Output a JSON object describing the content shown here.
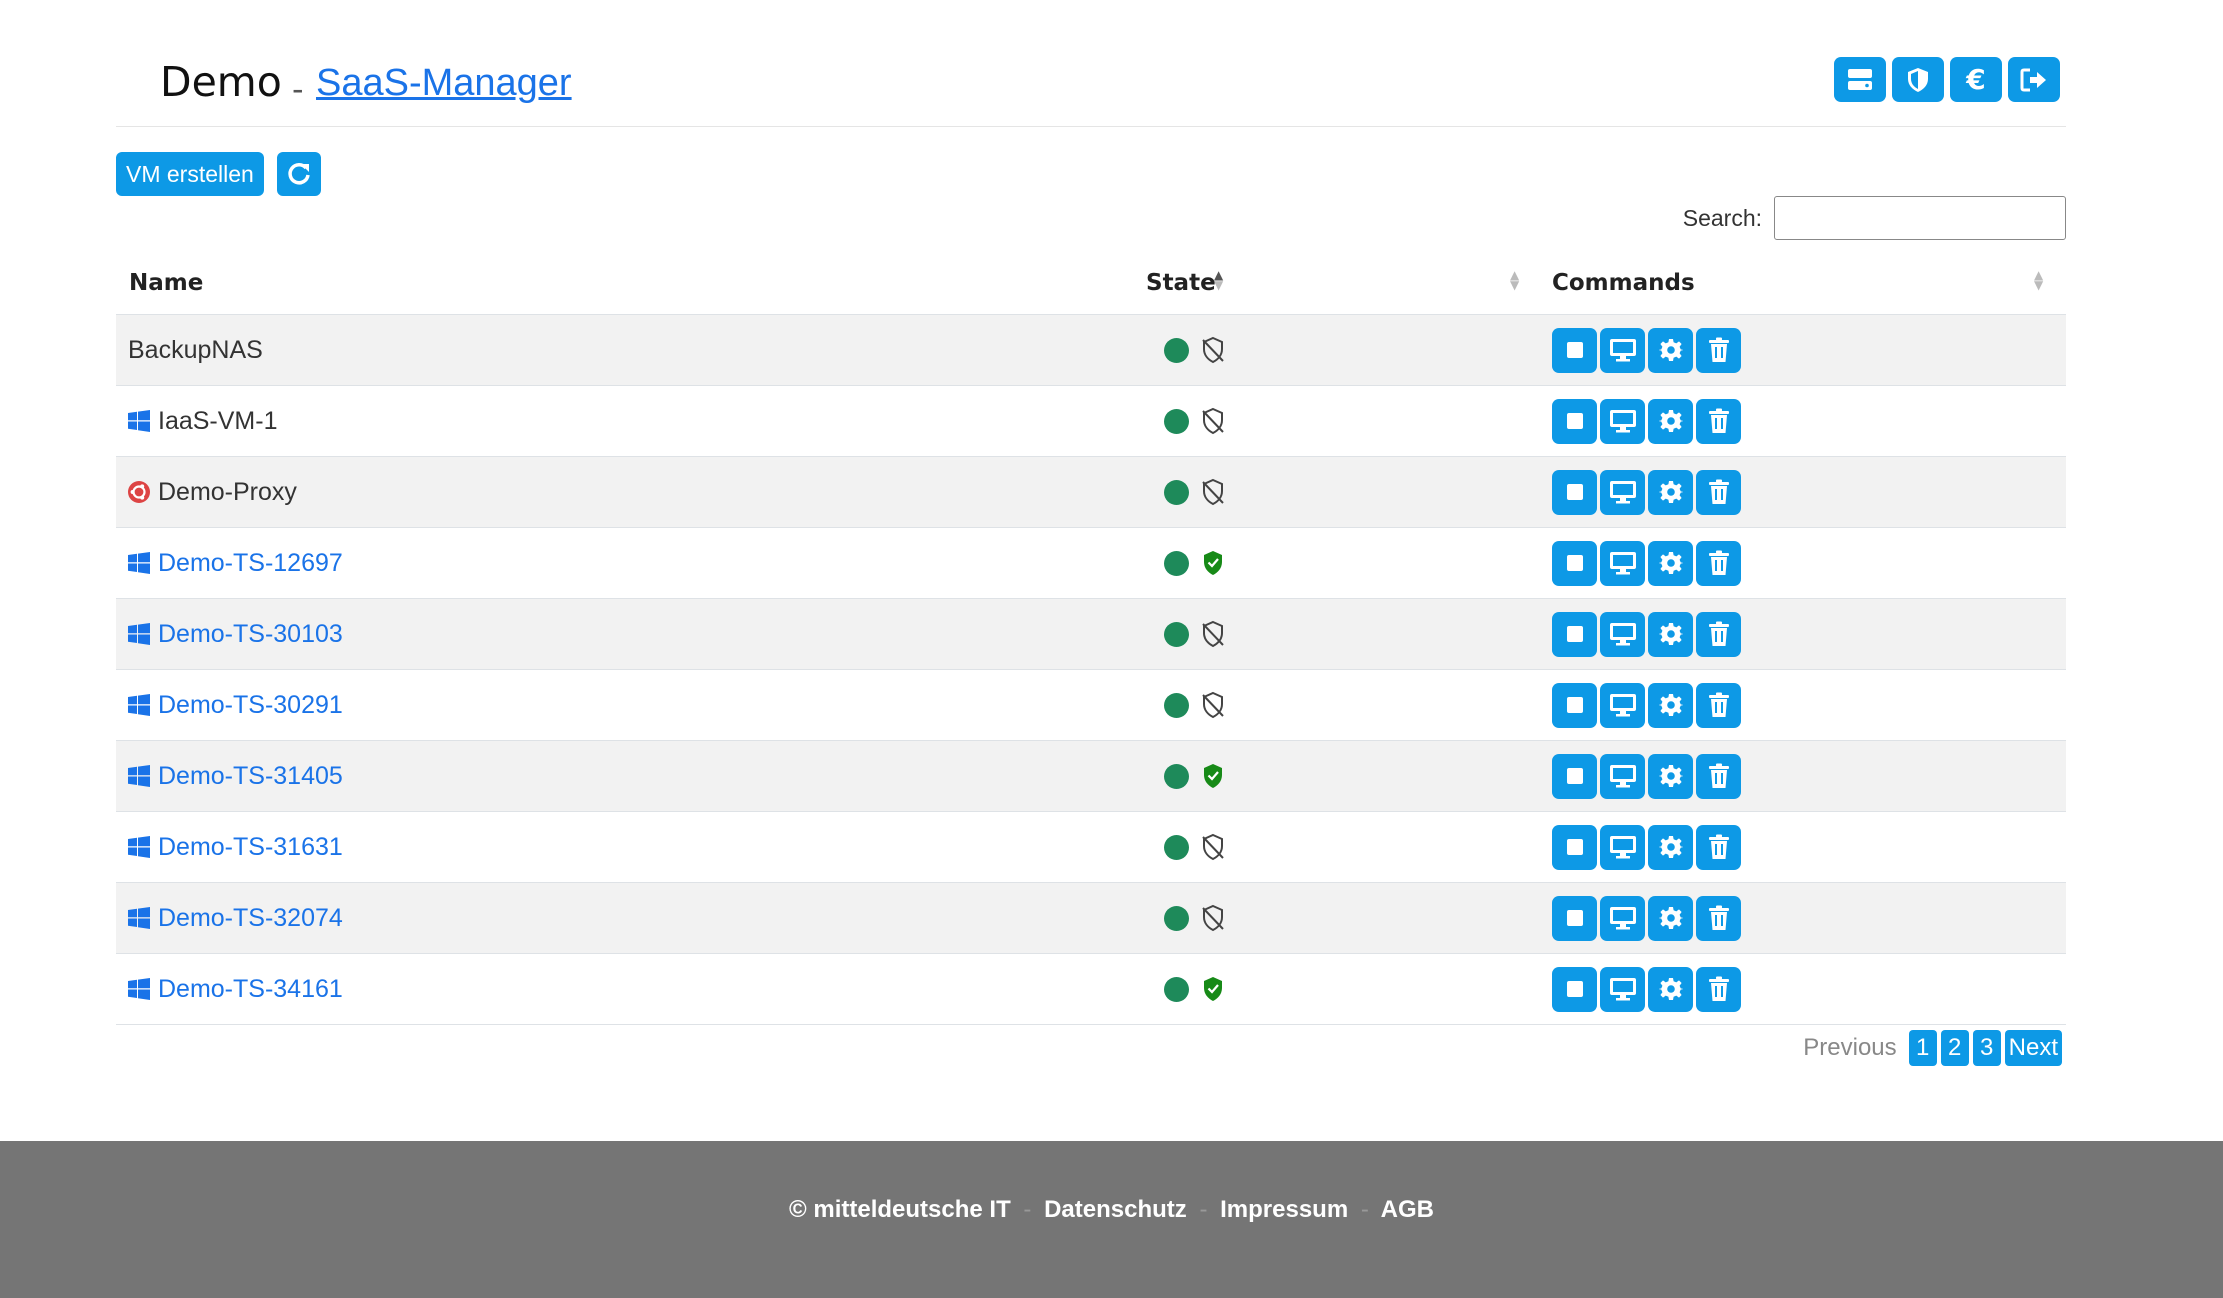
{
  "header": {
    "brand": "Demo",
    "separator": "-",
    "subtitle": "SaaS-Manager",
    "actions": [
      {
        "name": "server-icon"
      },
      {
        "name": "shield-icon"
      },
      {
        "name": "euro-icon"
      },
      {
        "name": "logout-icon"
      }
    ]
  },
  "toolbar": {
    "create_vm_label": "VM erstellen",
    "refresh_icon": "refresh-icon"
  },
  "search": {
    "label": "Search:",
    "value": "",
    "placeholder": ""
  },
  "table": {
    "columns": [
      "Name",
      "State",
      "Commands"
    ],
    "rows": [
      {
        "name": "BackupNAS",
        "os": "none",
        "link": false,
        "power": "running",
        "protected": false
      },
      {
        "name": "IaaS-VM-1",
        "os": "windows",
        "link": false,
        "power": "running",
        "protected": false
      },
      {
        "name": "Demo-Proxy",
        "os": "ubuntu",
        "link": false,
        "power": "running",
        "protected": false
      },
      {
        "name": "Demo-TS-12697",
        "os": "windows",
        "link": true,
        "power": "running",
        "protected": true
      },
      {
        "name": "Demo-TS-30103",
        "os": "windows",
        "link": true,
        "power": "running",
        "protected": false
      },
      {
        "name": "Demo-TS-30291",
        "os": "windows",
        "link": true,
        "power": "running",
        "protected": false
      },
      {
        "name": "Demo-TS-31405",
        "os": "windows",
        "link": true,
        "power": "running",
        "protected": true
      },
      {
        "name": "Demo-TS-31631",
        "os": "windows",
        "link": true,
        "power": "running",
        "protected": false
      },
      {
        "name": "Demo-TS-32074",
        "os": "windows",
        "link": true,
        "power": "running",
        "protected": false
      },
      {
        "name": "Demo-TS-34161",
        "os": "windows",
        "link": true,
        "power": "running",
        "protected": true
      }
    ],
    "commands": [
      "stop-icon",
      "console-icon",
      "settings-icon",
      "delete-icon"
    ]
  },
  "pagination": {
    "previous": "Previous",
    "pages": [
      "1",
      "2",
      "3"
    ],
    "next": "Next"
  },
  "footer": {
    "copyright": "© mitteldeutsche IT",
    "links": [
      "Datenschutz",
      "Impressum",
      "AGB"
    ],
    "separator": "-"
  },
  "colors": {
    "accent": "#0d99e6",
    "link": "#1a73e8",
    "status_running": "#1e8a5a",
    "shield_ok": "#178a17",
    "footer_bg": "#757575"
  }
}
